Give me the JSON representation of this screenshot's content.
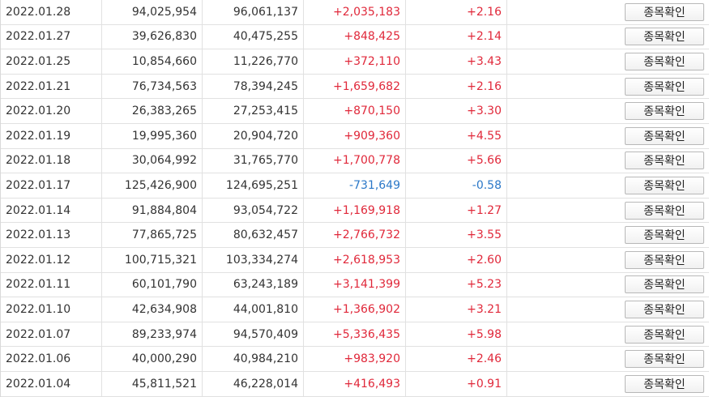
{
  "colors": {
    "up": "#e0283a",
    "down": "#2b78c8",
    "text": "#333333",
    "border": "#e1e1e1"
  },
  "rows": [
    {
      "date": "2022.01.28",
      "a": "94,025,954",
      "b": "96,061,137",
      "change": "+2,035,183",
      "pct": "+2.16",
      "dir": "up",
      "button": "종목확인"
    },
    {
      "date": "2022.01.27",
      "a": "39,626,830",
      "b": "40,475,255",
      "change": "+848,425",
      "pct": "+2.14",
      "dir": "up",
      "button": "종목확인"
    },
    {
      "date": "2022.01.25",
      "a": "10,854,660",
      "b": "11,226,770",
      "change": "+372,110",
      "pct": "+3.43",
      "dir": "up",
      "button": "종목확인"
    },
    {
      "date": "2022.01.21",
      "a": "76,734,563",
      "b": "78,394,245",
      "change": "+1,659,682",
      "pct": "+2.16",
      "dir": "up",
      "button": "종목확인"
    },
    {
      "date": "2022.01.20",
      "a": "26,383,265",
      "b": "27,253,415",
      "change": "+870,150",
      "pct": "+3.30",
      "dir": "up",
      "button": "종목확인"
    },
    {
      "date": "2022.01.19",
      "a": "19,995,360",
      "b": "20,904,720",
      "change": "+909,360",
      "pct": "+4.55",
      "dir": "up",
      "button": "종목확인"
    },
    {
      "date": "2022.01.18",
      "a": "30,064,992",
      "b": "31,765,770",
      "change": "+1,700,778",
      "pct": "+5.66",
      "dir": "up",
      "button": "종목확인"
    },
    {
      "date": "2022.01.17",
      "a": "125,426,900",
      "b": "124,695,251",
      "change": "-731,649",
      "pct": "-0.58",
      "dir": "down",
      "button": "종목확인"
    },
    {
      "date": "2022.01.14",
      "a": "91,884,804",
      "b": "93,054,722",
      "change": "+1,169,918",
      "pct": "+1.27",
      "dir": "up",
      "button": "종목확인"
    },
    {
      "date": "2022.01.13",
      "a": "77,865,725",
      "b": "80,632,457",
      "change": "+2,766,732",
      "pct": "+3.55",
      "dir": "up",
      "button": "종목확인"
    },
    {
      "date": "2022.01.12",
      "a": "100,715,321",
      "b": "103,334,274",
      "change": "+2,618,953",
      "pct": "+2.60",
      "dir": "up",
      "button": "종목확인"
    },
    {
      "date": "2022.01.11",
      "a": "60,101,790",
      "b": "63,243,189",
      "change": "+3,141,399",
      "pct": "+5.23",
      "dir": "up",
      "button": "종목확인"
    },
    {
      "date": "2022.01.10",
      "a": "42,634,908",
      "b": "44,001,810",
      "change": "+1,366,902",
      "pct": "+3.21",
      "dir": "up",
      "button": "종목확인"
    },
    {
      "date": "2022.01.07",
      "a": "89,233,974",
      "b": "94,570,409",
      "change": "+5,336,435",
      "pct": "+5.98",
      "dir": "up",
      "button": "종목확인"
    },
    {
      "date": "2022.01.06",
      "a": "40,000,290",
      "b": "40,984,210",
      "change": "+983,920",
      "pct": "+2.46",
      "dir": "up",
      "button": "종목확인"
    },
    {
      "date": "2022.01.04",
      "a": "45,811,521",
      "b": "46,228,014",
      "change": "+416,493",
      "pct": "+0.91",
      "dir": "up",
      "button": "종목확인"
    }
  ]
}
